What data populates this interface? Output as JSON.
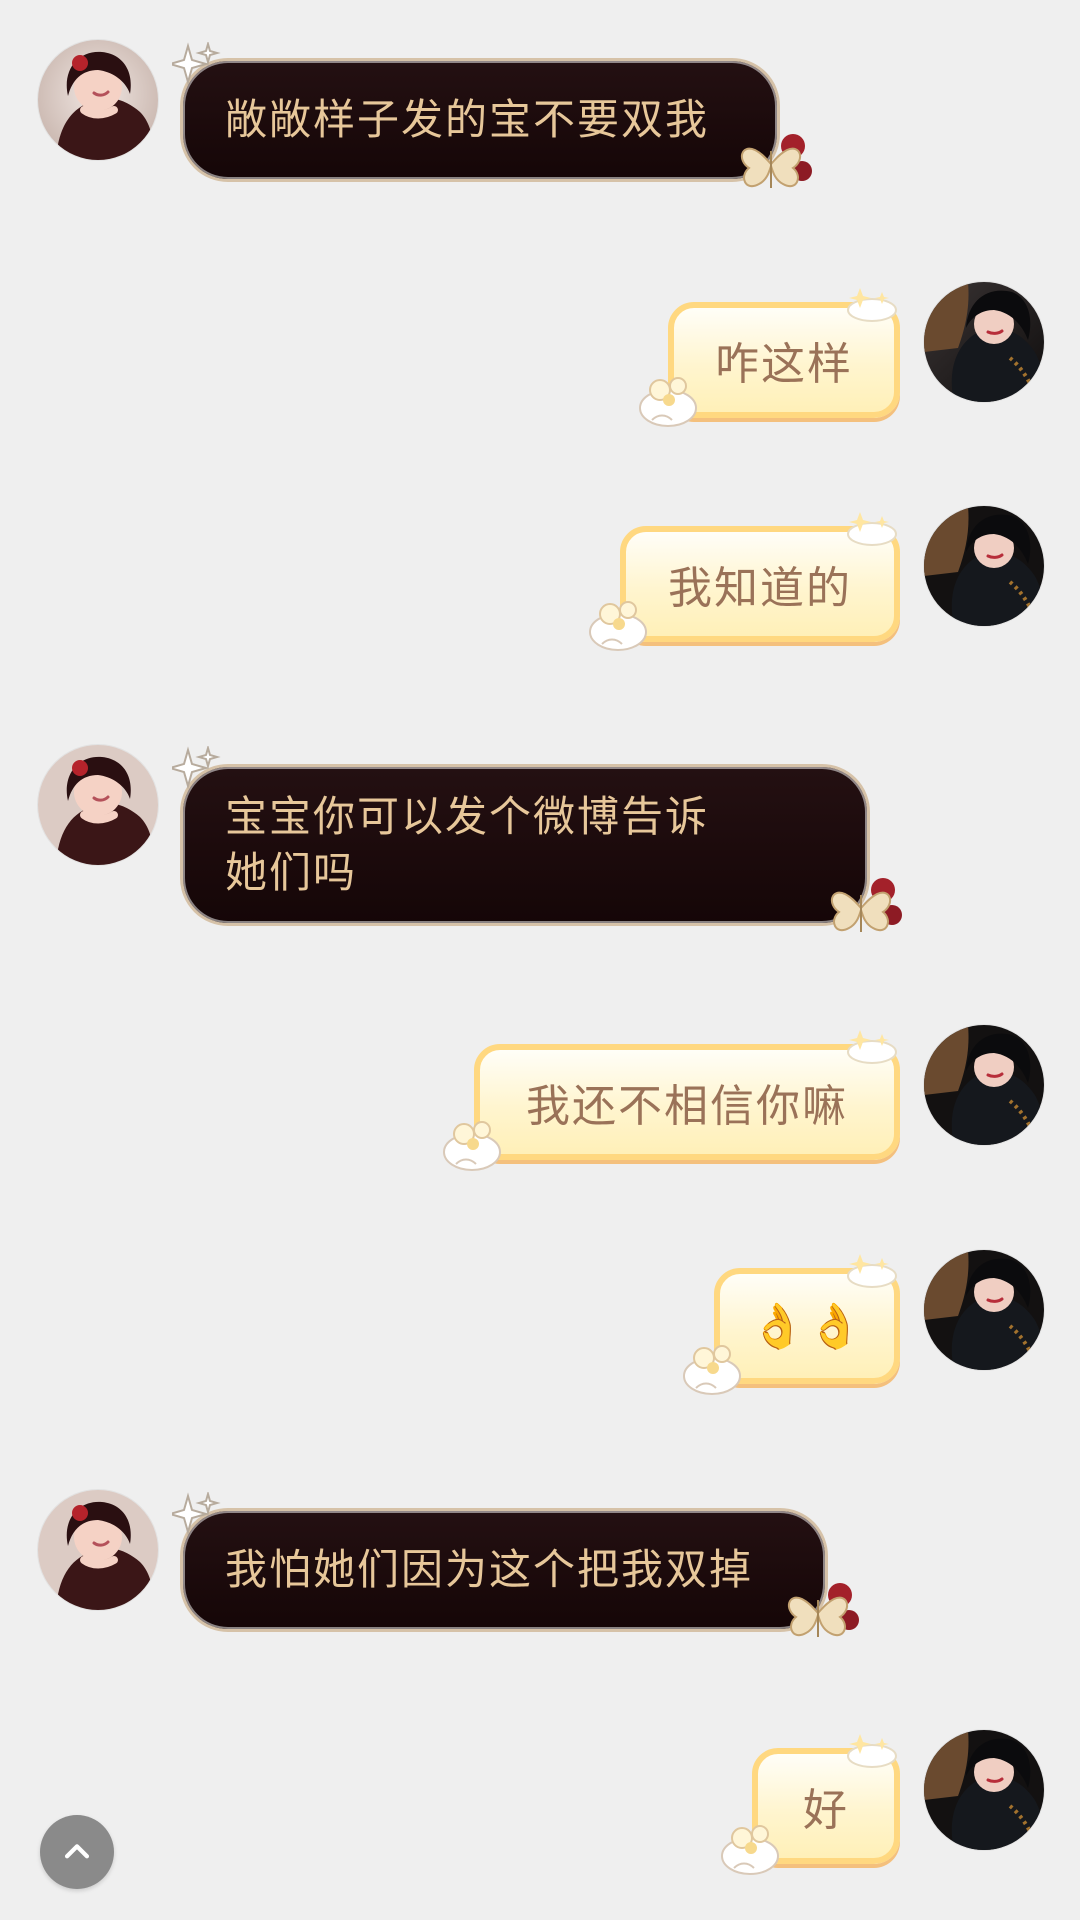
{
  "messages": [
    {
      "side": "left",
      "text": "敞敞样子发的宝不要双我"
    },
    {
      "side": "right",
      "text": "咋这样"
    },
    {
      "side": "right",
      "text": "我知道的"
    },
    {
      "side": "left",
      "text": "宝宝你可以发个微博告诉她们吗"
    },
    {
      "side": "right",
      "text": "我还不相信你嘛"
    },
    {
      "side": "right",
      "text": "👌👌"
    },
    {
      "side": "left",
      "text": "我怕她们因为这个把我双掉"
    },
    {
      "side": "right",
      "text": "好"
    }
  ],
  "colors": {
    "background": "#efefef",
    "dark_bubble": "#1a0708",
    "dark_text": "#e7c79a",
    "light_bubble": "#fff5cf",
    "light_border": "#ffd880",
    "light_text": "#9a7258"
  },
  "icons": {
    "scroll_top": "chevron-up-icon",
    "dark_bubble_decoration": "butterfly-rose-icon",
    "light_bubble_decoration": "cloud-flower-icon"
  }
}
